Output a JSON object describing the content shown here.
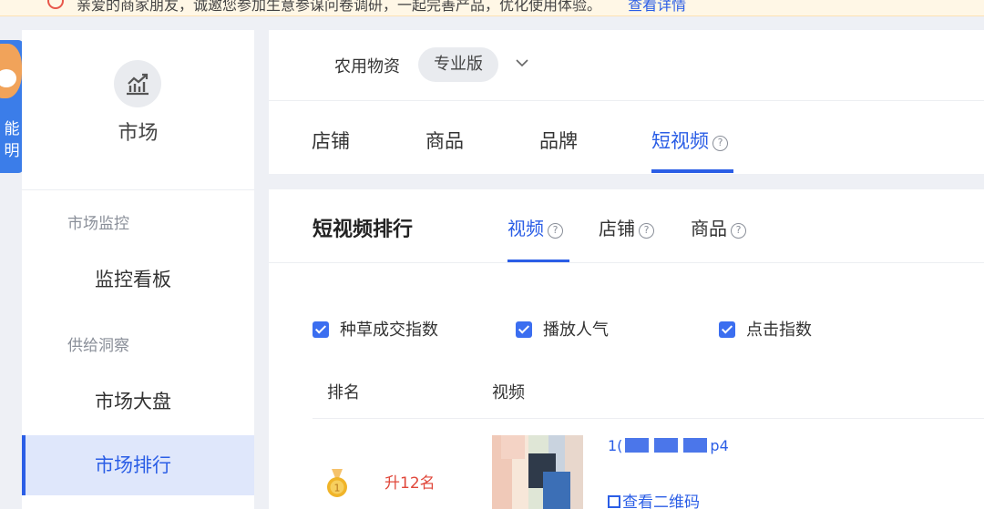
{
  "notice": {
    "text": "亲爱的商家朋友，诚邀您参加生意参谋问卷调研，一起完善产品，优化使用体验。",
    "link": "查看详情"
  },
  "mascot": {
    "text": "能明"
  },
  "sidebar": {
    "title": "市场",
    "groups": [
      {
        "label": "市场监控",
        "items": [
          {
            "label": "监控看板"
          }
        ]
      },
      {
        "label": "供给洞察",
        "items": [
          {
            "label": "市场大盘"
          },
          {
            "label": "市场排行",
            "active": true
          }
        ]
      }
    ]
  },
  "header": {
    "category": "农用物资",
    "version": "专业版",
    "tabs": [
      {
        "label": "店铺"
      },
      {
        "label": "商品"
      },
      {
        "label": "品牌"
      },
      {
        "label": "短视频",
        "active": true,
        "help": "?"
      }
    ]
  },
  "ranking": {
    "title": "短视频排行",
    "tabs": [
      {
        "label": "视频",
        "active": true,
        "help": "?"
      },
      {
        "label": "店铺",
        "help": "?"
      },
      {
        "label": "商品",
        "help": "?"
      }
    ],
    "metrics": [
      {
        "label": "种草成交指数",
        "checked": true
      },
      {
        "label": "播放人气",
        "checked": true
      },
      {
        "label": "点击指数",
        "checked": true
      }
    ],
    "columns": [
      "排名",
      "视频"
    ],
    "rows": [
      {
        "rank_change": "升12名",
        "file_prefix": "1(",
        "file_suffix": "p4",
        "author": "",
        "qr_label": "查看二维码"
      }
    ]
  },
  "colors": {
    "accent": "#2b5ee6",
    "rank_up": "#e0473a",
    "medal": "#f0b429"
  }
}
